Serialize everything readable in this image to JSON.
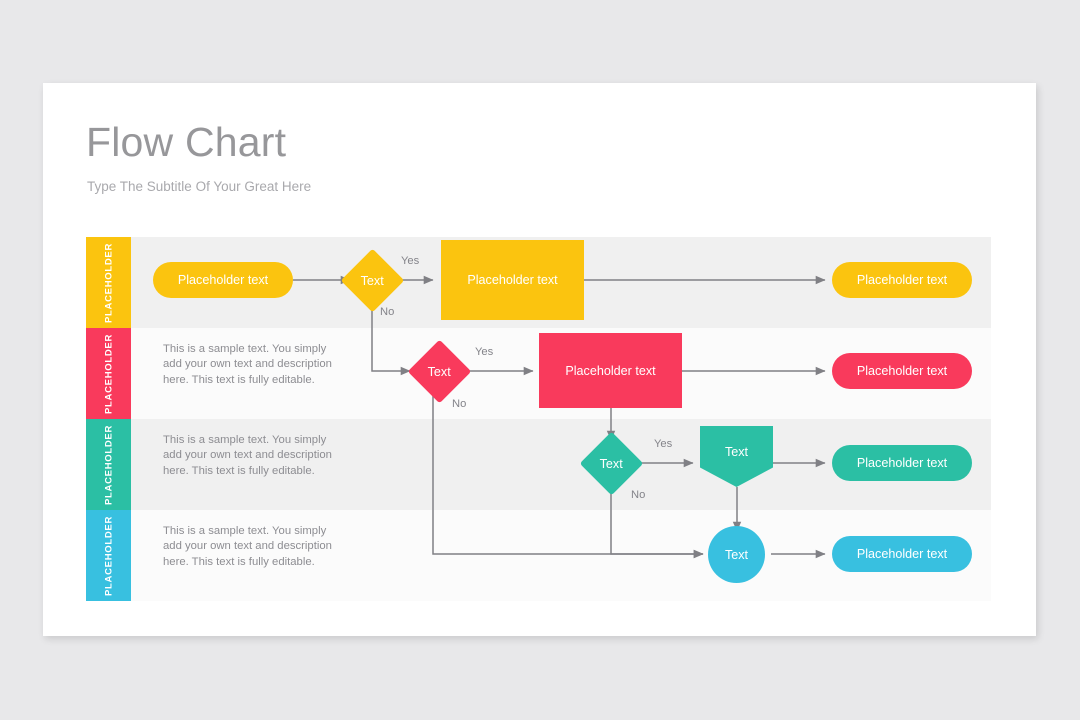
{
  "slide": {
    "title": "Flow Chart",
    "subtitle": "Type The Subtitle Of Your Great Here"
  },
  "palette": {
    "amber": "#FBC40F",
    "pink": "#F93A5C",
    "teal": "#2BBFA4",
    "cyan": "#38C0E0",
    "connector": "#808085",
    "title_gray": "#97979A",
    "body_gray": "#8D8D92",
    "row_shaded": "#F0F0F0",
    "row_plain": "#FBFBFB"
  },
  "sample_text": "This is a sample text. You simply add your own text and description here. This text is fully editable.",
  "edge_labels": {
    "yes": "Yes",
    "no": "No"
  },
  "rows": [
    {
      "tab_label": "PLACEHOLDER",
      "color": "#FBC40F",
      "description": "",
      "nodes": [
        {
          "shape": "pill",
          "label": "Placeholder text"
        },
        {
          "shape": "diamond",
          "label": "Text"
        },
        {
          "shape": "rect",
          "label": "Placeholder text"
        },
        {
          "shape": "pill",
          "label": "Placeholder text"
        }
      ],
      "labels": [
        "Yes",
        "No"
      ]
    },
    {
      "tab_label": "PLACEHOLDER",
      "color": "#F93A5C",
      "description": "This is a sample text. You simply add your own text and description here. This text is fully editable.",
      "nodes": [
        {
          "shape": "diamond",
          "label": "Text"
        },
        {
          "shape": "rect",
          "label": "Placeholder text"
        },
        {
          "shape": "pill",
          "label": "Placeholder text"
        }
      ],
      "labels": [
        "Yes",
        "No"
      ]
    },
    {
      "tab_label": "PLACEHOLDER",
      "color": "#2BBFA4",
      "description": "This is a sample text. You simply add your own text and description here. This text is fully editable.",
      "nodes": [
        {
          "shape": "diamond",
          "label": "Text"
        },
        {
          "shape": "pentagon",
          "label": "Text"
        },
        {
          "shape": "pill",
          "label": "Placeholder text"
        }
      ],
      "labels": [
        "Yes",
        "No"
      ]
    },
    {
      "tab_label": "PLACEHOLDER",
      "color": "#38C0E0",
      "description": "This is a sample text. You simply add your own text and description here. This text is fully editable.",
      "nodes": [
        {
          "shape": "circle",
          "label": "Text"
        },
        {
          "shape": "pill",
          "label": "Placeholder text"
        }
      ],
      "labels": []
    }
  ]
}
